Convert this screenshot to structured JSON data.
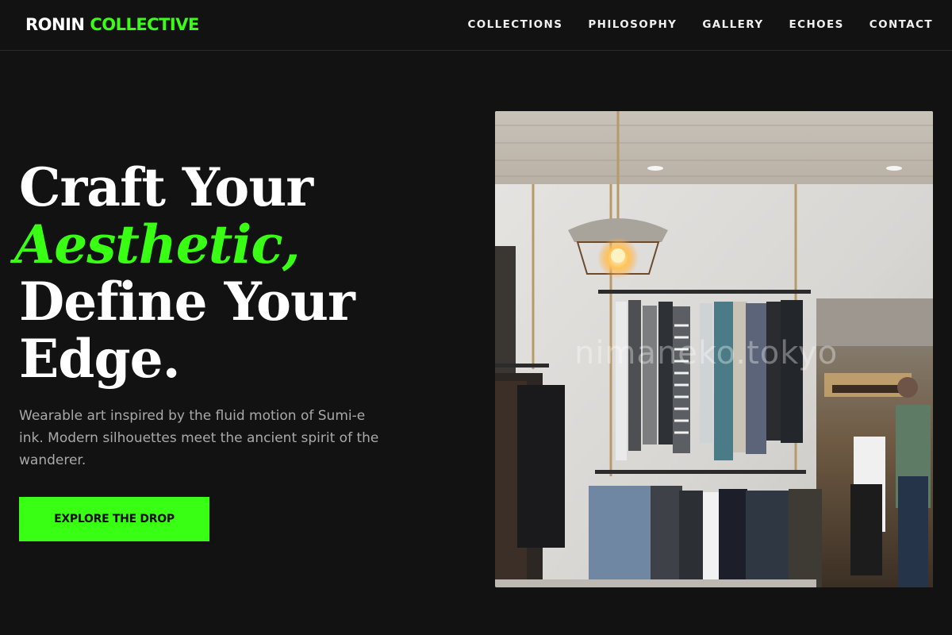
{
  "brand": {
    "part1": "RONIN",
    "part2": "COLLECTIVE"
  },
  "nav": [
    "COLLECTIONS",
    "PHILOSOPHY",
    "GALLERY",
    "ECHOES",
    "CONTACT"
  ],
  "hero": {
    "line1": "Craft Your",
    "line2": "Aesthetic,",
    "line3": "Define Your",
    "line4": "Edge.",
    "subtext": "Wearable art inspired by the fluid motion of Sumi-e ink. Modern silhouettes meet the ancient spirit of the wanderer.",
    "cta": "EXPLORE THE DROP"
  },
  "image": {
    "watermark": "nimaneko.tokyo"
  },
  "colors": {
    "accent": "#39ff14",
    "background": "#121212",
    "text": "#ffffff",
    "muted": "#a9a9a9"
  }
}
